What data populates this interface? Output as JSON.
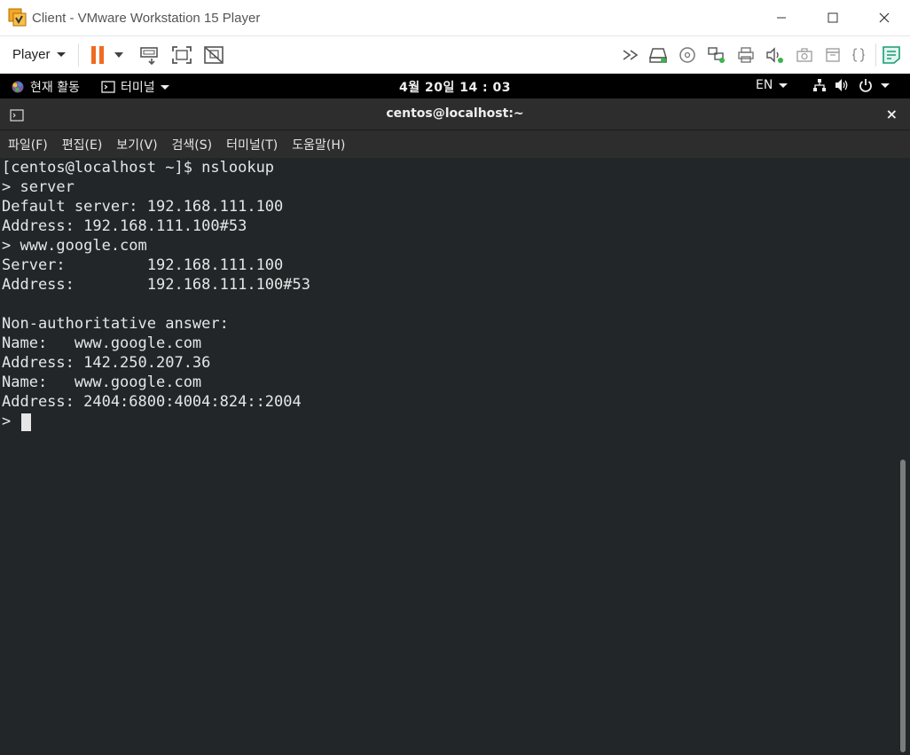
{
  "window": {
    "title": "Client - VMware Workstation 15 Player",
    "minimize_icon": "minimize-icon",
    "maximize_icon": "maximize-icon",
    "close_icon": "close-icon"
  },
  "toolbar": {
    "player_label": "Player",
    "pause_color": "#f06a21",
    "icons": [
      "pause-icon",
      "send-ctrl-alt-del-icon",
      "fullscreen-icon",
      "unity-icon",
      "forward-icon",
      "hard-disk-icon",
      "cd-dvd-icon",
      "network-adapter-icon",
      "printer-icon",
      "sound-card-icon",
      "camera-icon",
      "usb-icon",
      "more-devices-icon",
      "message-log-icon"
    ]
  },
  "gnome": {
    "activities": "현재 활동",
    "app_menu": "터미널",
    "clock": "4월 20일  14 : 03",
    "language": "EN"
  },
  "terminal": {
    "title": "centos@localhost:~",
    "close": "×",
    "menu": [
      "파일(F)",
      "편집(E)",
      "보기(V)",
      "검색(S)",
      "터미널(T)",
      "도움말(H)"
    ],
    "lines": [
      "[centos@localhost ~]$ nslookup",
      "> server",
      "Default server: 192.168.111.100",
      "Address: 192.168.111.100#53",
      "> www.google.com",
      "Server:         192.168.111.100",
      "Address:        192.168.111.100#53",
      "",
      "Non-authoritative answer:",
      "Name:   www.google.com",
      "Address: 142.250.207.36",
      "Name:   www.google.com",
      "Address: 2404:6800:4004:824::2004",
      ">"
    ],
    "background": "#222629",
    "foreground": "#e6e6e6"
  }
}
